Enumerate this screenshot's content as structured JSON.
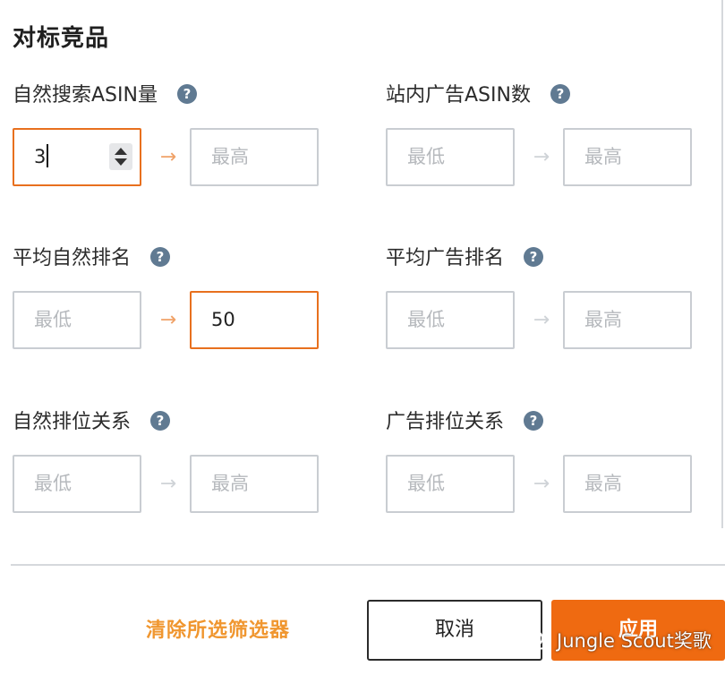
{
  "section": {
    "title": "对标竞品"
  },
  "help_icon_glyph": "?",
  "arrow_glyph": "→",
  "filters": [
    {
      "label": "自然搜索ASIN量",
      "min": {
        "value": "3",
        "placeholder": "最低"
      },
      "max": {
        "value": "",
        "placeholder": "最高"
      }
    },
    {
      "label": "站内广告ASIN数",
      "min": {
        "value": "",
        "placeholder": "最低"
      },
      "max": {
        "value": "",
        "placeholder": "最高"
      }
    },
    {
      "label": "平均自然排名",
      "min": {
        "value": "",
        "placeholder": "最低"
      },
      "max": {
        "value": "50",
        "placeholder": "最高"
      }
    },
    {
      "label": "平均广告排名",
      "min": {
        "value": "",
        "placeholder": "最低"
      },
      "max": {
        "value": "",
        "placeholder": "最高"
      }
    },
    {
      "label": "自然排位关系",
      "min": {
        "value": "",
        "placeholder": "最低"
      },
      "max": {
        "value": "",
        "placeholder": "最高"
      }
    },
    {
      "label": "广告排位关系",
      "min": {
        "value": "",
        "placeholder": "最低"
      },
      "max": {
        "value": "",
        "placeholder": "最高"
      }
    }
  ],
  "footer": {
    "clear_label": "清除所选筛选器",
    "cancel_label": "取消",
    "apply_label": "应用"
  },
  "watermark": {
    "text": "Jungle Scout奖歌"
  },
  "colors": {
    "accent": "#ef6a11",
    "focus_border": "#e8701e",
    "clear_link": "#f0962f",
    "help_icon": "#607a92"
  }
}
